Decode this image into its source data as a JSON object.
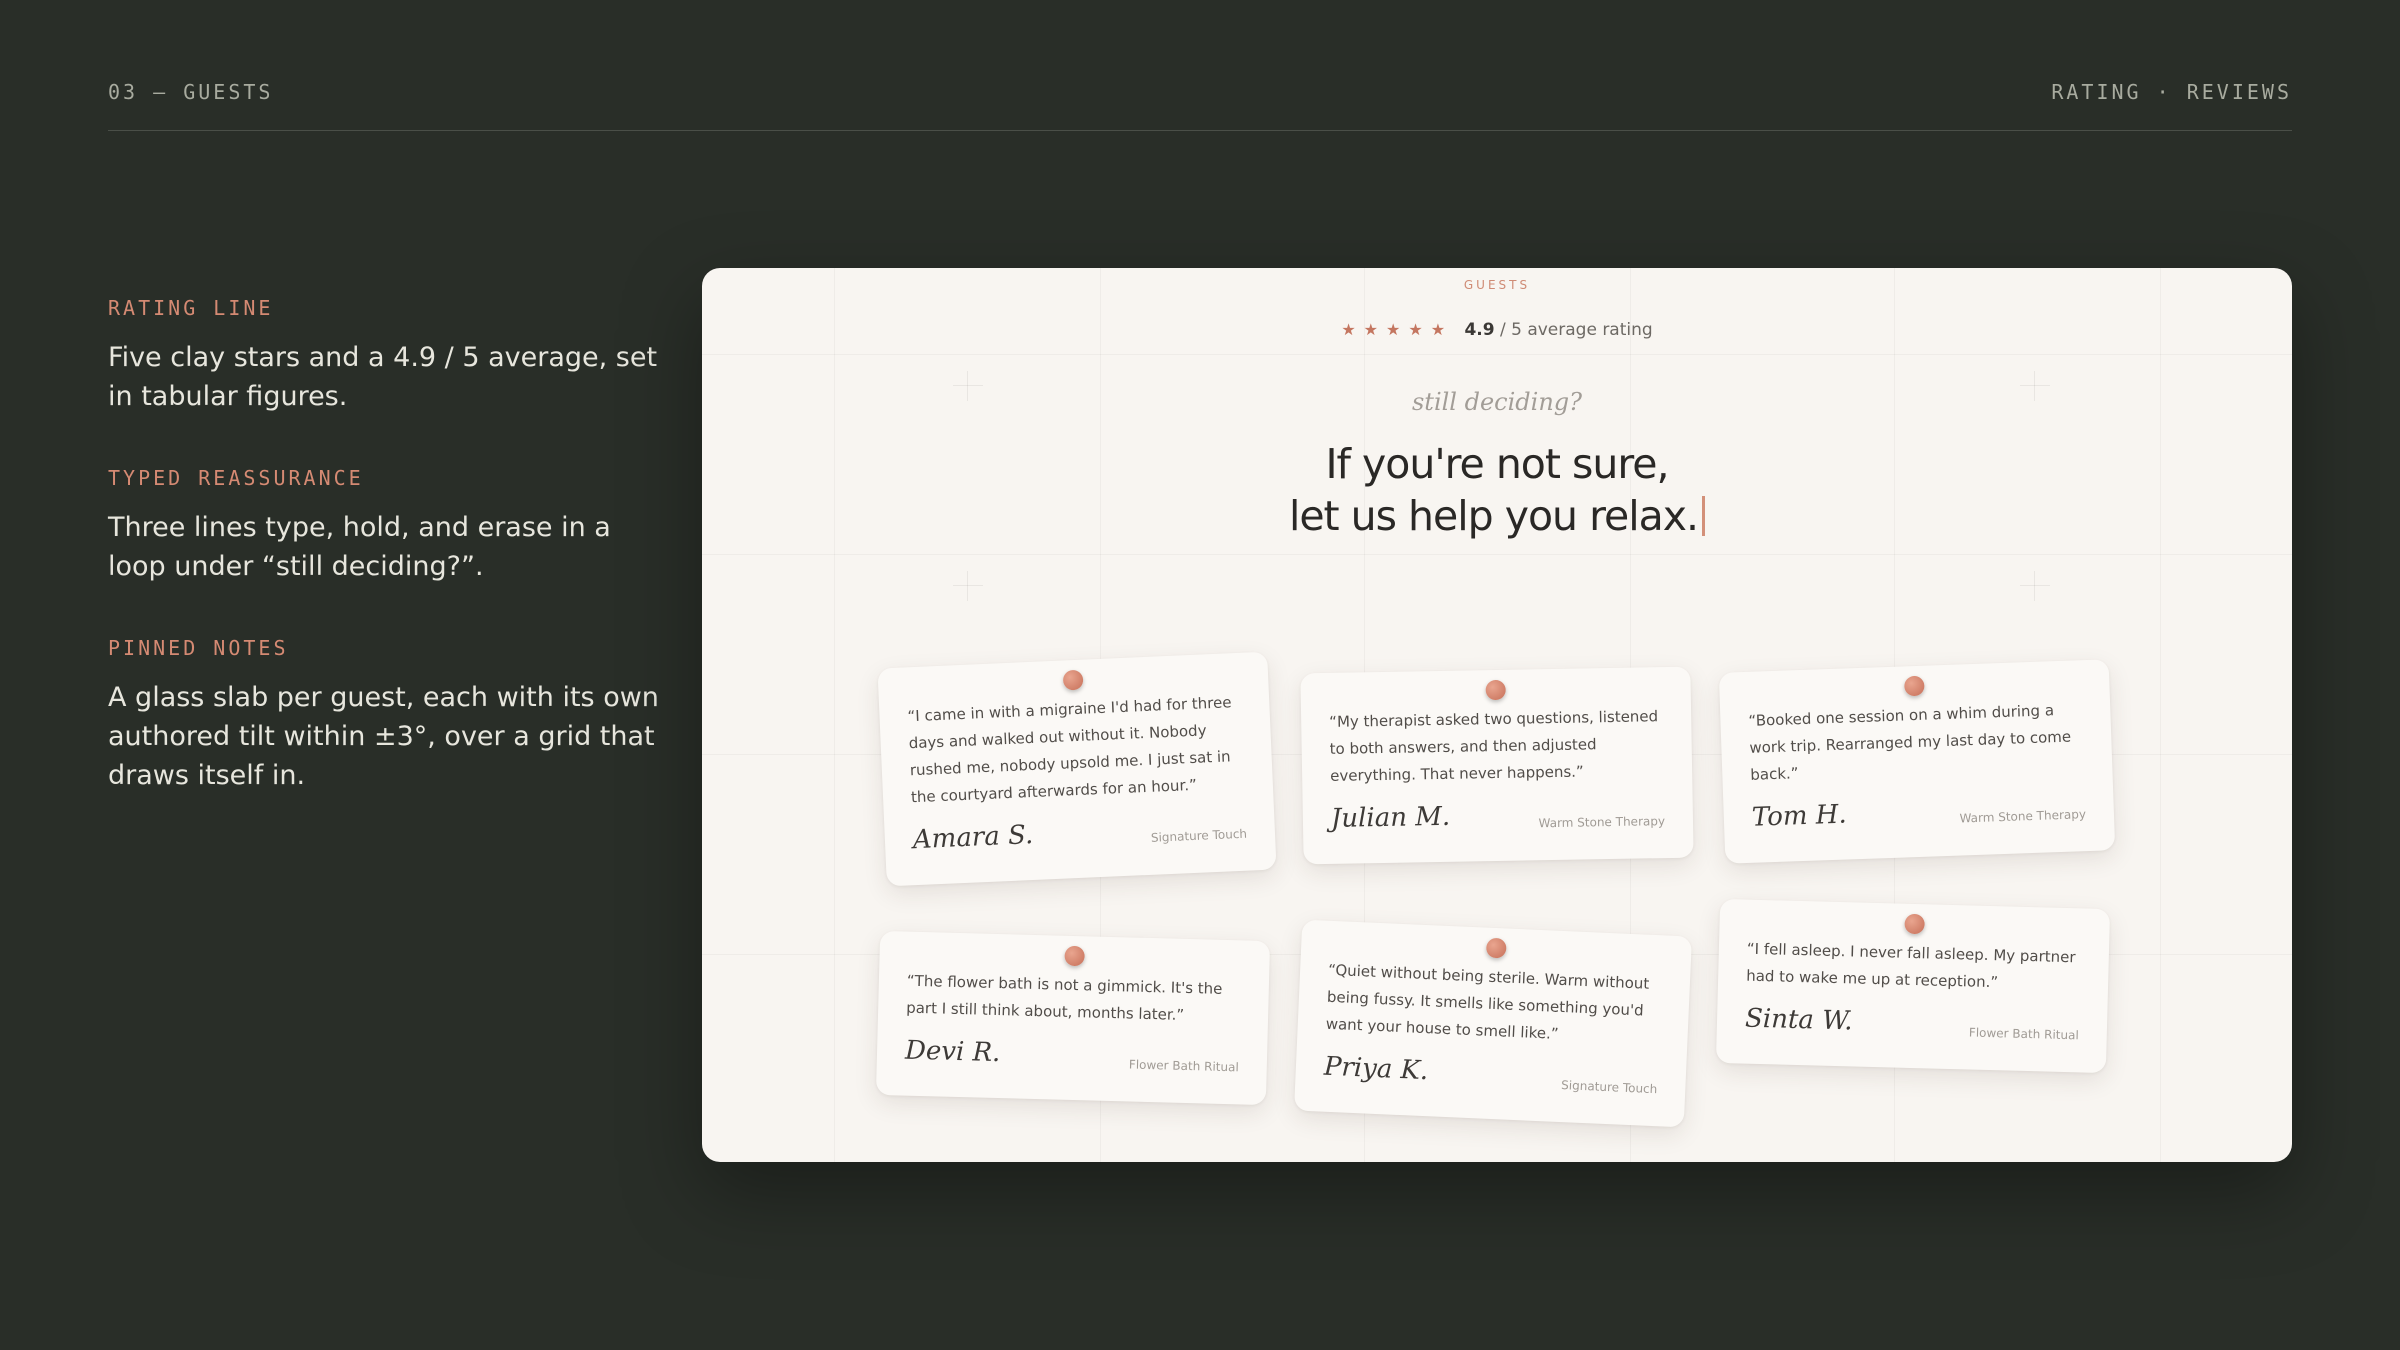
{
  "header": {
    "section": "03 — GUESTS",
    "meta": "RATING · REVIEWS"
  },
  "notes": [
    {
      "label": "RATING LINE",
      "text": "Five clay stars and a 4.9 / 5 average, set in tabular figures."
    },
    {
      "label": "TYPED REASSURANCE",
      "text": "Three lines type, hold, and erase in a loop under “still deciding?”."
    },
    {
      "label": "PINNED NOTES",
      "text": "A glass slab per guest, each with its own authored tilt within ±3°, over a grid that draws itself in."
    }
  ],
  "panel": {
    "eyebrow": "GUESTS",
    "stars": "★★★★★",
    "rating_value": "4.9",
    "rating_suffix": "/ 5 average rating",
    "deciding": "still deciding?",
    "headline_line1": "If you're not sure,",
    "headline_line2": "let us help you relax."
  },
  "colors": {
    "background": "#292e28",
    "accent": "#d58a73",
    "panel": "#f8f5f1"
  },
  "testimonials": [
    {
      "quote": "“I came in with a migraine I'd had for three days and walked out without it. Nobody rushed me, nobody upsold me. I just sat in the courtyard afterwards for an hour.”",
      "name": "Amara S.",
      "service": "Signature Touch"
    },
    {
      "quote": "“My therapist asked two questions, listened to both answers, and then adjusted everything. That never happens.”",
      "name": "Julian M.",
      "service": "Warm Stone Therapy"
    },
    {
      "quote": "“Booked one session on a whim during a work trip. Rearranged my last day to come back.”",
      "name": "Tom H.",
      "service": "Warm Stone Therapy"
    },
    {
      "quote": "“The flower bath is not a gimmick. It's the part I still think about, months later.”",
      "name": "Devi R.",
      "service": "Flower Bath Ritual"
    },
    {
      "quote": "“Quiet without being sterile. Warm without being fussy. It smells like something you'd want your house to smell like.”",
      "name": "Priya K.",
      "service": "Signature Touch"
    },
    {
      "quote": "“I fell asleep. I never fall asleep. My partner had to wake me up at reception.”",
      "name": "Sinta W.",
      "service": "Flower Bath Ritual"
    }
  ]
}
